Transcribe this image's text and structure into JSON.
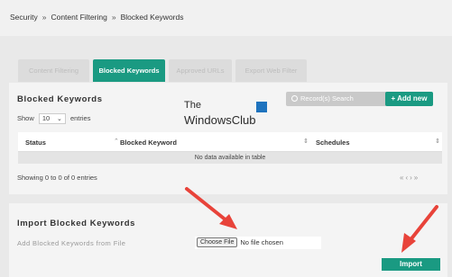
{
  "breadcrumb": {
    "items": [
      "Security",
      "Content Filtering",
      "Blocked Keywords"
    ],
    "separator": "»"
  },
  "tabs": [
    {
      "label": "Content Filtering",
      "active": false
    },
    {
      "label": "Blocked Keywords",
      "active": true
    },
    {
      "label": "Approved URLs",
      "active": false
    },
    {
      "label": "Export Web Filter",
      "active": false
    }
  ],
  "blocked": {
    "title": "Blocked Keywords",
    "search_placeholder": "Record(s) Search",
    "add_label": "+ Add new",
    "show_label": "Show",
    "entries_value": "10",
    "entries_label": "entries",
    "columns": [
      "Status",
      "Blocked Keyword",
      "Schedules"
    ],
    "empty_text": "No data available in table",
    "showing_text": "Showing 0 to 0 of 0 entries",
    "pager": "«‹›»"
  },
  "import": {
    "title": "Import Blocked Keywords",
    "label": "Add Blocked Keywords from File",
    "choose_label": "Choose File",
    "file_status": "No file chosen",
    "import_label": "Import"
  },
  "watermark": {
    "line1": "The",
    "line2": "WindowsClub"
  },
  "colors": {
    "accent": "#1a9a82",
    "arrow": "#e8433a",
    "logo_blue": "#1e73be"
  }
}
